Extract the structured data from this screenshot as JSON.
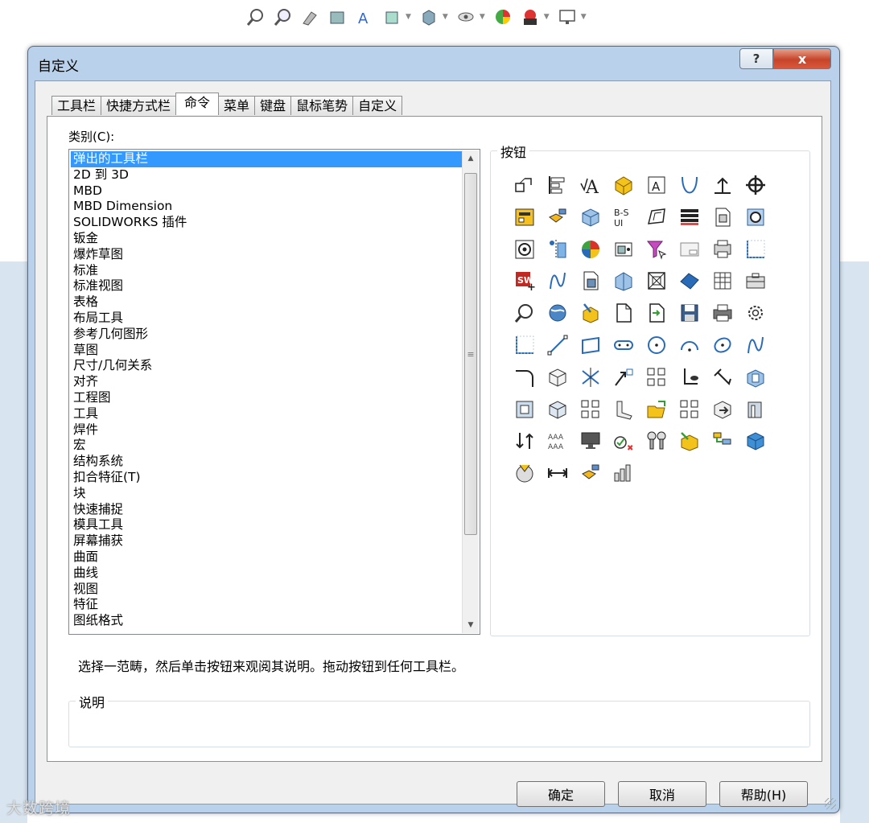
{
  "dialog": {
    "title": "自定义",
    "help_glyph": "?",
    "close_glyph": "x"
  },
  "tabs": [
    {
      "label": "工具栏"
    },
    {
      "label": "快捷方式栏"
    },
    {
      "label": "命令",
      "active": true
    },
    {
      "label": "菜单"
    },
    {
      "label": "键盘"
    },
    {
      "label": "鼠标笔势"
    },
    {
      "label": "自定义"
    }
  ],
  "category": {
    "label": "类别(C):",
    "items": [
      "弹出的工具栏",
      "2D 到 3D",
      "MBD",
      "MBD Dimension",
      "SOLIDWORKS 插件",
      "钣金",
      "爆炸草图",
      "标准",
      "标准视图",
      "表格",
      "布局工具",
      "参考几何图形",
      "草图",
      "尺寸/几何关系",
      "对齐",
      "工程图",
      "工具",
      "焊件",
      "宏",
      "结构系统",
      "扣合特征(T)",
      "块",
      "快速捕捉",
      "模具工具",
      "屏幕捕获",
      "曲面",
      "曲线",
      "视图",
      "特征",
      "图纸格式"
    ],
    "selected_index": 0
  },
  "buttons_group": {
    "title": "按钮"
  },
  "instruction": "选择一范畴，然后单击按钮来观阅其说明。拖动按钮到任何工具栏。",
  "description_group": {
    "title": "说明"
  },
  "footer": {
    "ok": "确定",
    "cancel": "取消",
    "help": "帮助(H)"
  },
  "watermark": "大数跨境",
  "colors": {
    "selection": "#3399ff",
    "dialog_frame": "#b9d1ea",
    "close_red": "#c6442a"
  }
}
